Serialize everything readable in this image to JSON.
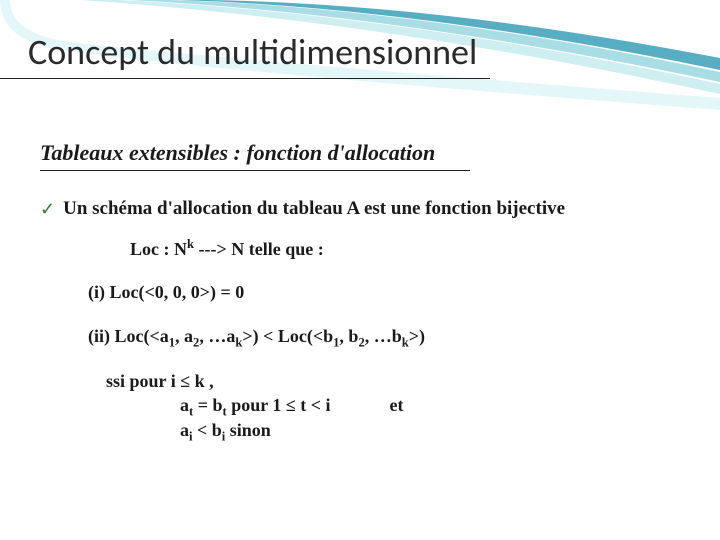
{
  "title": "Concept du multidimensionnel",
  "subtitle": "Tableaux extensibles : fonction d'allocation",
  "bullet": "Un schéma d'allocation du tableau A est une fonction bijective",
  "loc_def_pre": "Loc : N",
  "loc_def_sup": "k",
  "loc_def_post": " ---> N  telle que  :",
  "cond_i": "(i)  Loc(<0, 0,   0>) = 0",
  "cond_ii_line1_html": "(ii) Loc(&lt;a<sub>1</sub>, a<sub>2</sub>, …a<sub>k</sub>&gt;) &lt; Loc(&lt;b<sub>1</sub>, b<sub>2</sub>, …b<sub>k</sub>&gt;)",
  "cond_ii_line2_html": "ssi pour i ≤ k ,",
  "cond_ii_line3_html": "a<sub>t</sub> = b<sub>t</sub>  pour  1 ≤ t &lt; i <span class=\"et\"></span> et",
  "cond_ii_line4_html": "a<sub>i</sub> &lt; b<sub>i</sub>  sinon"
}
